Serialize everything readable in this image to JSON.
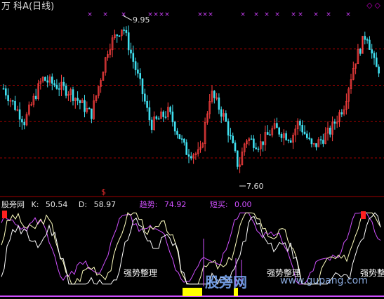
{
  "header": {
    "title": "万  科A(日线)",
    "corner_marks": "◇◇"
  },
  "price_chart": {
    "high_label": "9.95",
    "low_label": "7.60",
    "y_range": [
      7.4,
      10.1
    ],
    "grid_levels": [
      9.55,
      9.0,
      8.45,
      7.9
    ],
    "signal_mark": "$",
    "colors": {
      "up": "#ff4040",
      "down": "#40e0f0",
      "x_mark": "#d040ff",
      "grid": "#a00000"
    }
  },
  "indicator": {
    "name": "股旁网",
    "k_label": "K:",
    "k_value": "50.54",
    "d_label": "D:",
    "d_value": "58.97",
    "trend_label": "趋势:",
    "trend_value": "74.92",
    "shortbuy_label": "短买:",
    "shortbuy_value": "0.00",
    "zone_labels": [
      "强势整理",
      "强势整理",
      "强势整"
    ],
    "colors": {
      "k": "#ffffff",
      "d": "#ffffc0",
      "trend": "#d050ff",
      "signal": "#ff2020",
      "bar": "#ffff00"
    }
  },
  "watermark": {
    "text": "股旁网",
    "url": "www.gupang.com"
  }
}
